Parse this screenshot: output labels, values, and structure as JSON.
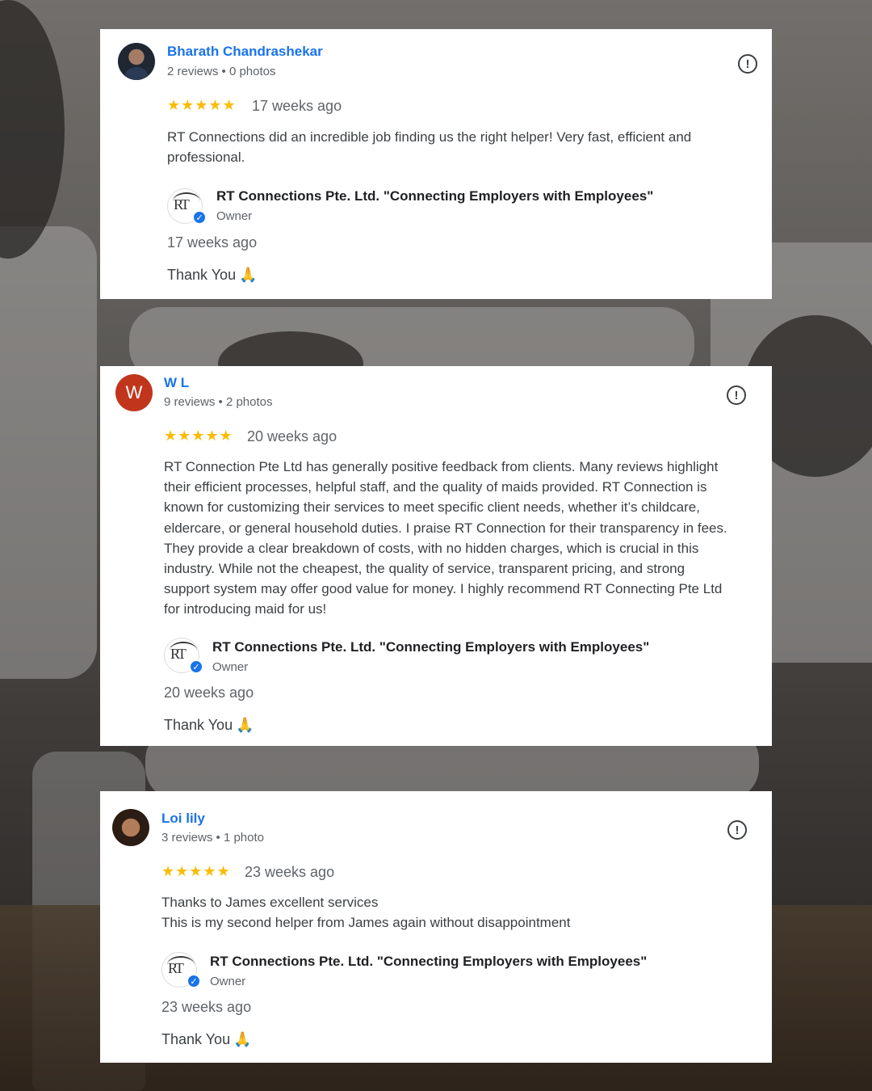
{
  "reviews": [
    {
      "name": "Bharath Chandrashekar",
      "meta": "2 reviews • 0 photos",
      "avatar_icon": "profile-photo",
      "avatar_letter": "",
      "stars": "★★★★★",
      "rating": 5,
      "when": "17 weeks ago",
      "text_lines": [
        "RT Connections did an incredible job finding us the right helper! Very fast, efficient and",
        "professional."
      ],
      "owner": {
        "name": "RT Connections Pte. Ltd. \"Connecting Employers with Employees\"",
        "role": "Owner",
        "when": "17 weeks ago",
        "reply": "Thank You",
        "reply_emoji": "🙏"
      }
    },
    {
      "name": "W L",
      "meta": "9 reviews • 2 photos",
      "avatar_icon": "letter-avatar",
      "avatar_letter": "W",
      "stars": "★★★★★",
      "rating": 5,
      "when": "20 weeks ago",
      "text_lines": [
        "RT Connection Pte Ltd has generally positive feedback from clients. Many reviews highlight",
        "their efficient processes, helpful staff, and the quality of maids provided. RT Connection is",
        "known for customizing their services to meet specific client needs, whether it’s childcare,",
        "eldercare, or general household duties. I praise RT Connection for their transparency in fees.",
        "They provide a clear breakdown of costs, with no hidden charges, which is crucial in this",
        "industry. While not the cheapest, the quality of service, transparent pricing, and strong",
        "support system may offer good value for money. I highly recommend RT Connecting Pte Ltd",
        "for introducing maid for us!"
      ],
      "owner": {
        "name": "RT Connections Pte. Ltd. \"Connecting Employers with Employees\"",
        "role": "Owner",
        "when": "20 weeks ago",
        "reply": "Thank You",
        "reply_emoji": "🙏"
      }
    },
    {
      "name": "Loi lily",
      "meta": "3 reviews • 1 photo",
      "avatar_icon": "profile-photo",
      "avatar_letter": "",
      "stars": "★★★★★",
      "rating": 5,
      "when": "23 weeks ago",
      "text_lines": [
        "Thanks to James excellent services",
        "This is my second helper from James again without disappointment"
      ],
      "owner": {
        "name": "RT Connections Pte. Ltd. \"Connecting Employers with Employees\"",
        "role": "Owner",
        "when": "23 weeks ago",
        "reply": "Thank You",
        "reply_emoji": "🙏"
      }
    }
  ],
  "owner_logo_text": "RT",
  "colors": {
    "name_link": "#1a73e8",
    "star": "#fbbc04",
    "letter_avatar": "#c1351d",
    "verified": "#1a73e8"
  }
}
